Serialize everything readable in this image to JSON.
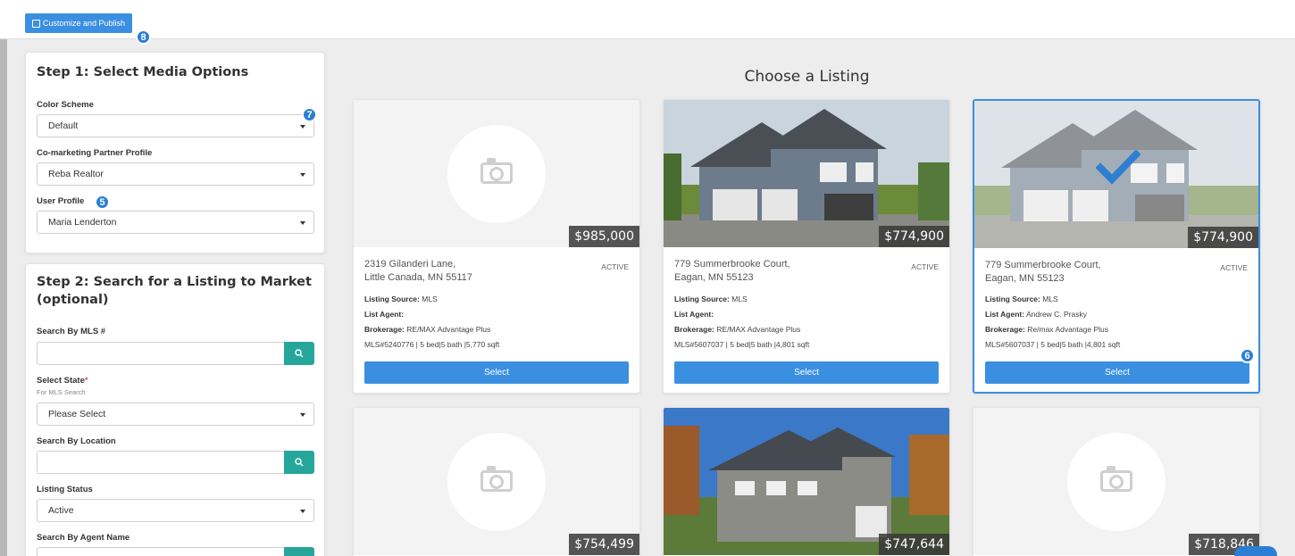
{
  "toolbar": {
    "publish_label": "Customize and Publish",
    "publish_badge": "8"
  },
  "step1": {
    "title": "Step 1: Select Media Options",
    "color_scheme": {
      "label": "Color Scheme",
      "value": "Default",
      "badge": "7"
    },
    "partner_profile": {
      "label": "Co-marketing Partner Profile",
      "value": "Reba Realtor"
    },
    "user_profile": {
      "label": "User Profile",
      "value": "Maria Lenderton",
      "badge": "5"
    }
  },
  "step2": {
    "title_line1": "Step 2: Search for a Listing to Market",
    "title_line2": "(optional)",
    "mls_search": {
      "label": "Search By MLS #"
    },
    "state": {
      "label": "Select State",
      "required_mark": "*",
      "sublabel": "For MLS Search",
      "value": "Please Select"
    },
    "location": {
      "label": "Search By Location"
    },
    "listing_status": {
      "label": "Listing Status",
      "value": "Active"
    },
    "agent_name": {
      "label": "Search By Agent Name"
    }
  },
  "main": {
    "title": "Choose a Listing",
    "listings": [
      {
        "price": "$985,000",
        "address_line1": "2319 Gilanderi Lane,",
        "address_line2": "Little Canada, MN 55117",
        "status": "ACTIVE",
        "source_label": "Listing Source:",
        "source": "MLS",
        "agent_label": "List Agent:",
        "agent": "",
        "brokerage_label": "Brokerage:",
        "brokerage": "RE/MAX Advantage Plus",
        "details": "MLS#5240776 | 5 bed|5 bath |5,770 sqft",
        "select_label": "Select",
        "photo": "placeholder-camera"
      },
      {
        "price": "$774,900",
        "address_line1": "779 Summerbrooke Court,",
        "address_line2": "Eagan, MN 55123",
        "status": "ACTIVE",
        "source_label": "Listing Source:",
        "source": "MLS",
        "agent_label": "List Agent:",
        "agent": "",
        "brokerage_label": "Brokerage:",
        "brokerage": "RE/MAX Advantage Plus",
        "details": "MLS#5607037 | 5 bed|5 bath |4,801 sqft",
        "select_label": "Select",
        "photo": "house"
      },
      {
        "price": "$774,900",
        "address_line1": "779 Summerbrooke Court,",
        "address_line2": "Eagan, MN 55123",
        "status": "ACTIVE",
        "source_label": "Listing Source:",
        "source": "MLS",
        "agent_label": "List Agent:",
        "agent": "Andrew C. Prasky",
        "brokerage_label": "Brokerage:",
        "brokerage": "Re/max Advantage Plus",
        "details": "MLS#5607037 | 5 bed|5 bath |4,801 sqft",
        "select_label": "Select",
        "select_badge": "6",
        "photo": "house-selected"
      },
      {
        "price": "$754,499",
        "photo": "placeholder-camera"
      },
      {
        "price": "$747,644",
        "photo": "house-autumn"
      },
      {
        "price": "$718,846",
        "photo": "placeholder-camera"
      }
    ]
  },
  "colors": {
    "accent": "#3b8fe0",
    "search_button": "#26a69a",
    "badge": "#2a7fd4"
  }
}
